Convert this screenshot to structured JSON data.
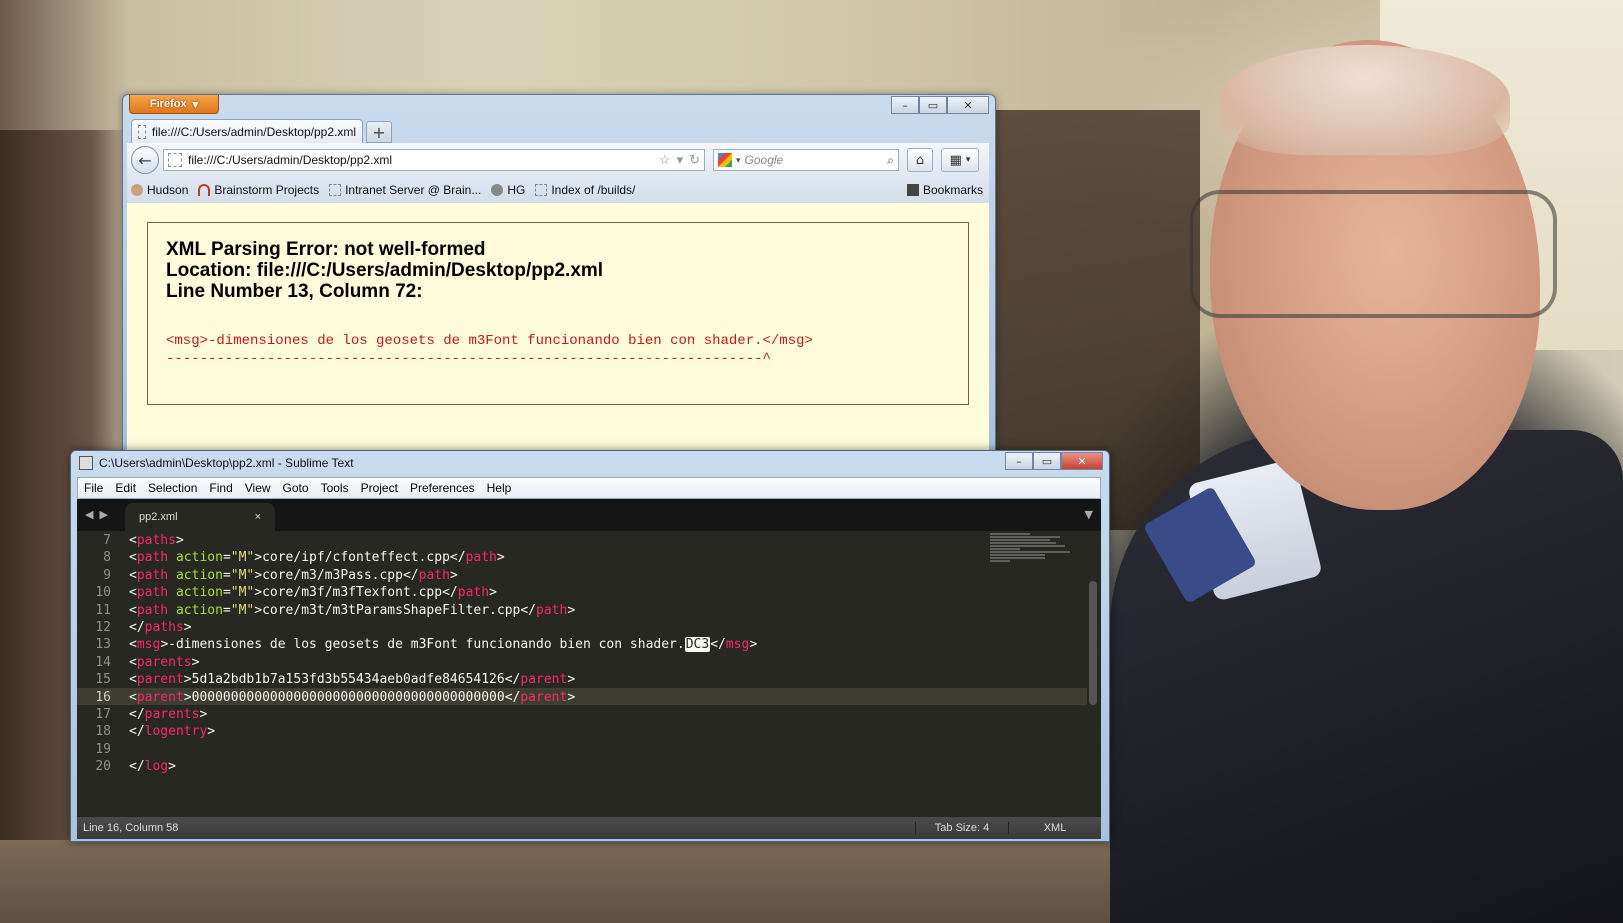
{
  "firefox": {
    "menu_label": "Firefox",
    "tab_title": "file:///C:/Users/admin/Desktop/pp2.xml",
    "url": "file:///C:/Users/admin/Desktop/pp2.xml",
    "search_placeholder": "Google",
    "bookmarks": [
      "Hudson",
      "Brainstorm Projects",
      "Intranet Server @ Brain...",
      "HG",
      "Index of /builds/"
    ],
    "bookmarks_menu": "Bookmarks",
    "error": {
      "title": "XML Parsing Error: not well-formed",
      "location": "Location: file:///C:/Users/admin/Desktop/pp2.xml",
      "line": "Line Number 13, Column 72:",
      "source": "<msg>-dimensiones de los geosets de m3Font funcionando bien con shader.</msg>",
      "pointer": "-----------------------------------------------------------------------^"
    }
  },
  "sublime": {
    "title": "C:\\Users\\admin\\Desktop\\pp2.xml - Sublime Text",
    "menu": [
      "File",
      "Edit",
      "Selection",
      "Find",
      "View",
      "Goto",
      "Tools",
      "Project",
      "Preferences",
      "Help"
    ],
    "tab": "pp2.xml",
    "line_numbers": [
      "7",
      "8",
      "9",
      "10",
      "11",
      "12",
      "13",
      "14",
      "15",
      "16",
      "17",
      "18",
      "19",
      "20"
    ],
    "status": {
      "position": "Line 16, Column 58",
      "tab_size": "Tab Size: 4",
      "syntax": "XML"
    }
  },
  "colors": {
    "tag": "#f92672",
    "attr": "#a6e22e",
    "string": "#e6db74",
    "editor_bg": "#272822",
    "error_text": "#c01a1a"
  }
}
